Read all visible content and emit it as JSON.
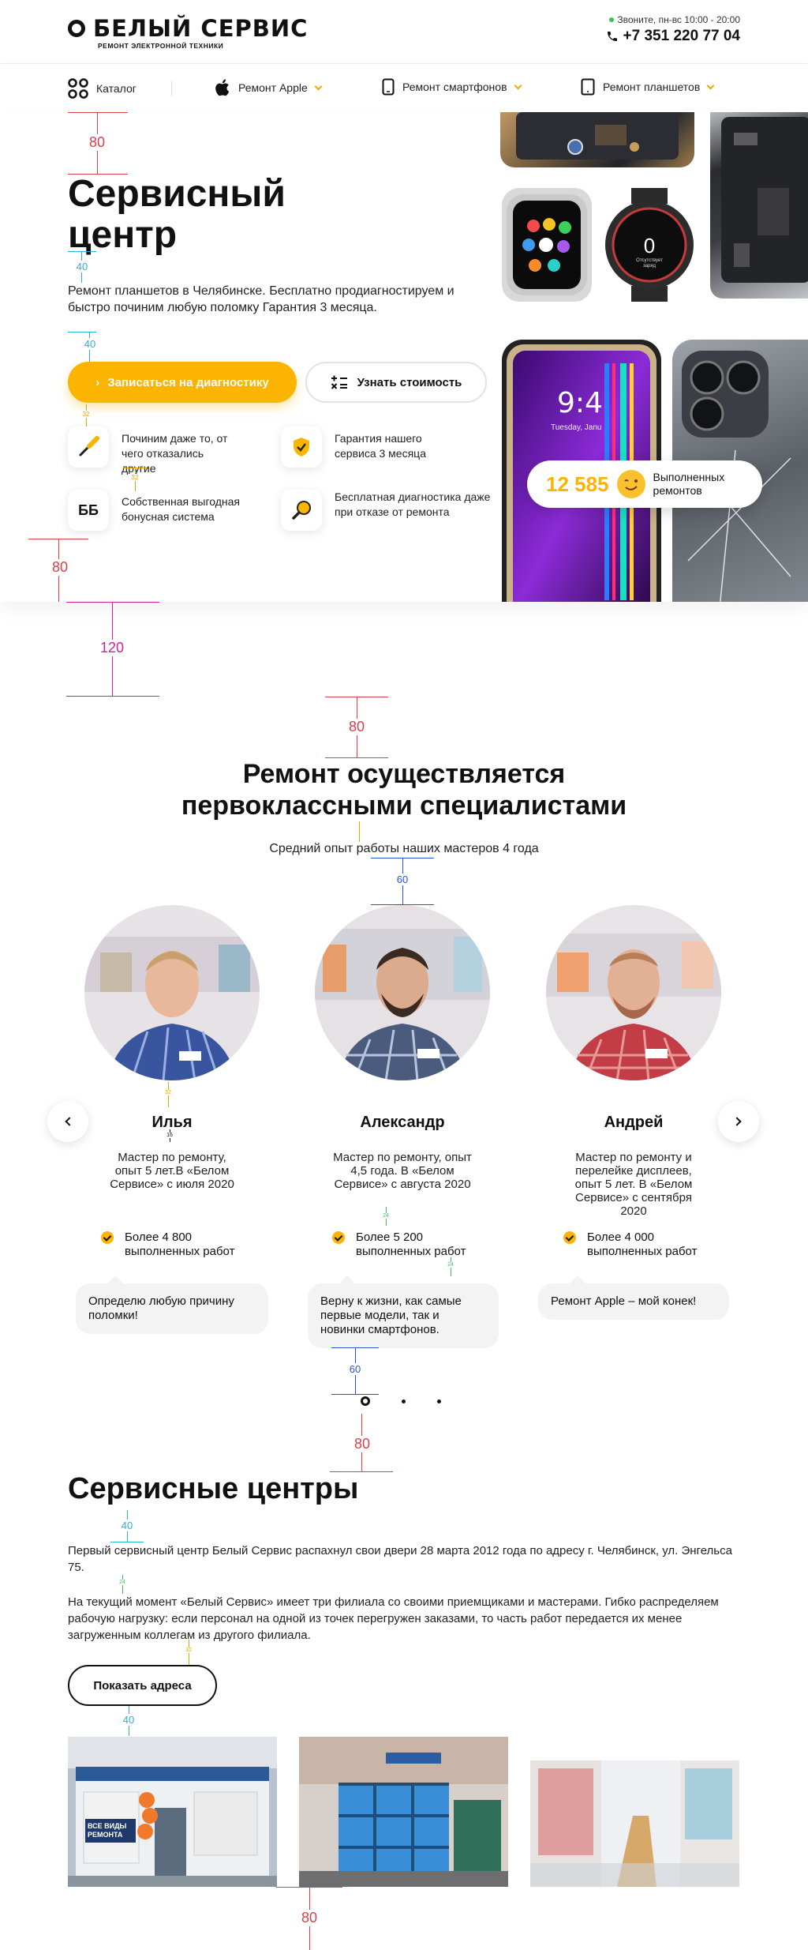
{
  "header": {
    "logo_title": "БЕЛЫЙ СЕРВИС",
    "logo_subtitle": "РЕМОНТ ЭЛЕКТРОННОЙ ТЕХНИКИ",
    "hours": "Звоните, пн-вс 10:00 - 20:00",
    "phone": "+7 351 220 77 04"
  },
  "nav": {
    "items": [
      {
        "label": "Каталог",
        "icon": "grid-icon"
      },
      {
        "label": "Ремонт Apple",
        "icon": "apple-icon"
      },
      {
        "label": "Ремонт смартфонов",
        "icon": "smartphone-icon"
      },
      {
        "label": "Ремонт планшетов",
        "icon": "tablet-icon"
      }
    ]
  },
  "hero": {
    "title_line1": "Сервисный",
    "title_line2": "центр",
    "description": "Ремонт планшетов в Челябинске. Бесплатно продиагностируем и быстро починим любую поломку Гарантия 3 месяца.",
    "primary_button": "Записаться на диагностику",
    "secondary_button": "Узнать стоимость",
    "features": [
      {
        "text": "Починим даже то, от чего отказались другие",
        "icon": "screwdriver-icon"
      },
      {
        "text": "Гарантия нашего сервиса 3 месяца",
        "icon": "shield-check-icon"
      },
      {
        "text": "Собственная выгодная бонусная система",
        "icon": "bonus-icon",
        "glyph": "ББ"
      },
      {
        "text": "Бесплатная диагностика даже при отказе от ремонта",
        "icon": "magnifier-icon"
      }
    ],
    "stat_number": "12 585",
    "stat_label": "Выполненных ремонтов",
    "stat_icon": "wink-emoji-icon",
    "watch_screen": "Отсутствует заряд",
    "phone_time": "9:4",
    "phone_date": "Tuesday, Janu"
  },
  "annotations": {
    "v80": "80",
    "v40": "40",
    "v32": "32",
    "v120": "120",
    "v60": "60",
    "v16": "16",
    "v24": "24"
  },
  "specialists": {
    "title_line1": "Ремонт осуществляется",
    "title_line2": "первоклассными специалистами",
    "subtitle": "Средний опыт работы наших мастеров 4 года",
    "masters": [
      {
        "name": "Илья",
        "desc": "Мастер по ремонту, опыт 5 лет.В «Белом Сервисе» с июля 2020",
        "stat": "Более 4 800 выполненных работ",
        "quote": "Определю любую причину поломки!"
      },
      {
        "name": "Александр",
        "desc": "Мастер по ремонту, опыт 4,5 года. В «Белом Сервисе» с августа 2020",
        "stat": "Более 5 200 выполненных работ",
        "quote": "Верну к жизни, как самые первые модели, так и новинки  смартфонов."
      },
      {
        "name": "Андрей",
        "desc": "Мастер по ремонту и перелейке дисплеев, опыт 5 лет. В «Белом Сервисе» с сентября 2020",
        "stat": "Более 4 000 выполненных работ",
        "quote": "Ремонт Apple – мой конек!"
      }
    ]
  },
  "service_centers": {
    "title": "Сервисные центры",
    "p1": "Первый сервисный центр Белый Сервис распахнул свои двери 28 марта 2012 года по адресу г. Челябинск, ул. Энгельса 75.",
    "p2": "На текущий момент «Белый Сервис» имеет три филиала со своими приемщиками и мастерами. Гибко распределяем рабочую нагрузку: если персонал на одной из точек перегружен заказами, то часть работ передается их менее загруженным коллегам из другого филиала.",
    "button": "Показать адреса",
    "storefront_sign": "ВСЕ ВИДЫ РЕМОНТА"
  },
  "colors": {
    "accent": "#fbb400",
    "annotation_red": "#d9404a",
    "annotation_cyan": "#25b6d2",
    "annotation_magenta": "#d01fa0",
    "annotation_blue": "#2a54d6"
  }
}
